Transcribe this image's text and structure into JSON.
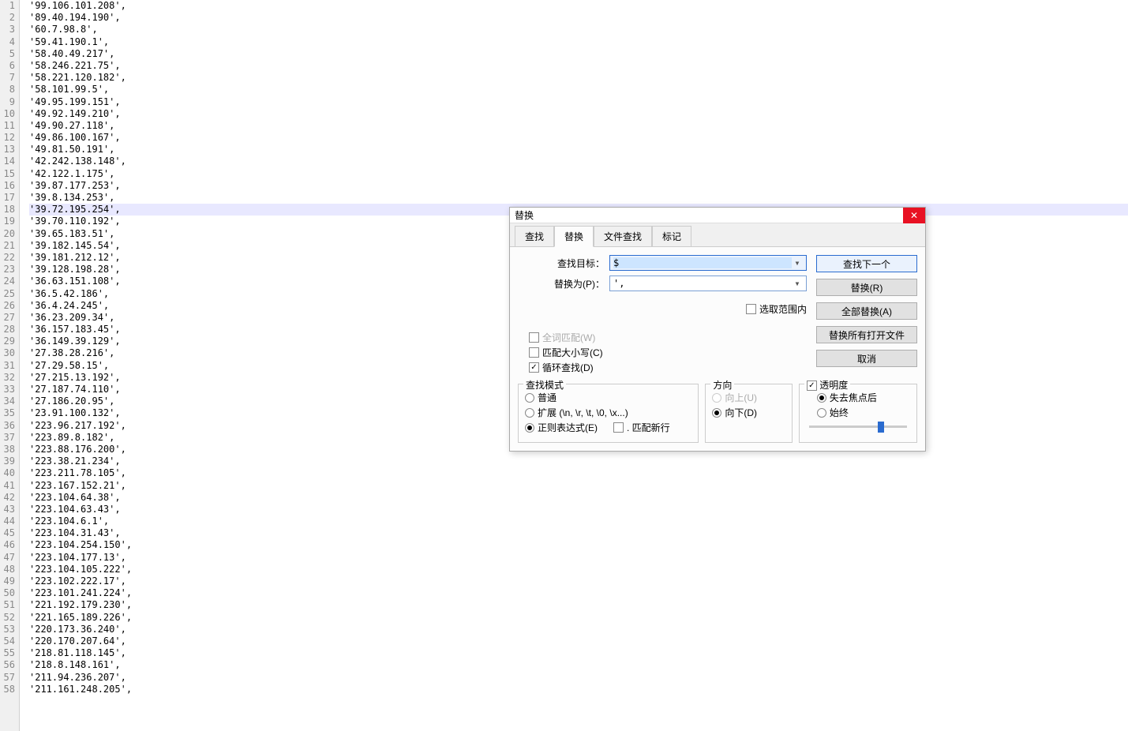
{
  "editor": {
    "lines": [
      "'99.106.101.208',",
      "'89.40.194.190',",
      "'60.7.98.8',",
      "'59.41.190.1',",
      "'58.40.49.217',",
      "'58.246.221.75',",
      "'58.221.120.182',",
      "'58.101.99.5',",
      "'49.95.199.151',",
      "'49.92.149.210',",
      "'49.90.27.118',",
      "'49.86.100.167',",
      "'49.81.50.191',",
      "'42.242.138.148',",
      "'42.122.1.175',",
      "'39.87.177.253',",
      "'39.8.134.253',",
      "'39.72.195.254',",
      "'39.70.110.192',",
      "'39.65.183.51',",
      "'39.182.145.54',",
      "'39.181.212.12',",
      "'39.128.198.28',",
      "'36.63.151.108',",
      "'36.5.42.186',",
      "'36.4.24.245',",
      "'36.23.209.34',",
      "'36.157.183.45',",
      "'36.149.39.129',",
      "'27.38.28.216',",
      "'27.29.58.15',",
      "'27.215.13.192',",
      "'27.187.74.110',",
      "'27.186.20.95',",
      "'23.91.100.132',",
      "'223.96.217.192',",
      "'223.89.8.182',",
      "'223.88.176.200',",
      "'223.38.21.234',",
      "'223.211.78.105',",
      "'223.167.152.21',",
      "'223.104.64.38',",
      "'223.104.63.43',",
      "'223.104.6.1',",
      "'223.104.31.43',",
      "'223.104.254.150',",
      "'223.104.177.13',",
      "'223.104.105.222',",
      "'223.102.222.17',",
      "'223.101.241.224',",
      "'221.192.179.230',",
      "'221.165.189.226',",
      "'220.173.36.240',",
      "'220.170.207.64',",
      "'218.81.118.145',",
      "'218.8.148.161',",
      "'211.94.236.207',",
      "'211.161.248.205',"
    ],
    "highlighted_line_index": 17
  },
  "dialog": {
    "title": "替换",
    "tabs": [
      "查找",
      "替换",
      "文件查找",
      "标记"
    ],
    "active_tab_index": 1,
    "find_label": "查找目标：",
    "find_value": "$",
    "replace_label": "替换为(P)：",
    "replace_value": "',",
    "buttons": {
      "find_next": "查找下一个",
      "replace": "替换(R)",
      "replace_all": "全部替换(A)",
      "replace_in_open": "替换所有打开文件",
      "cancel": "取消"
    },
    "in_selection": "选取范围内",
    "match_whole_word": "全词匹配(W)",
    "match_case": "匹配大小写(C)",
    "wrap_around": "循环查找(D)",
    "wrap_around_checked": true,
    "search_mode": {
      "legend": "查找模式",
      "normal": "普通",
      "extended": "扩展 (\\n, \\r, \\t, \\0, \\x...)",
      "regex": "正则表达式(E)",
      "dot_newline": ". 匹配新行",
      "selected": "regex"
    },
    "direction": {
      "legend": "方向",
      "up": "向上(U)",
      "down": "向下(D)",
      "selected": "down"
    },
    "transparency": {
      "legend": "透明度",
      "enabled": true,
      "on_lose_focus": "失去焦点后",
      "always": "始终",
      "selected": "on_lose_focus"
    }
  }
}
